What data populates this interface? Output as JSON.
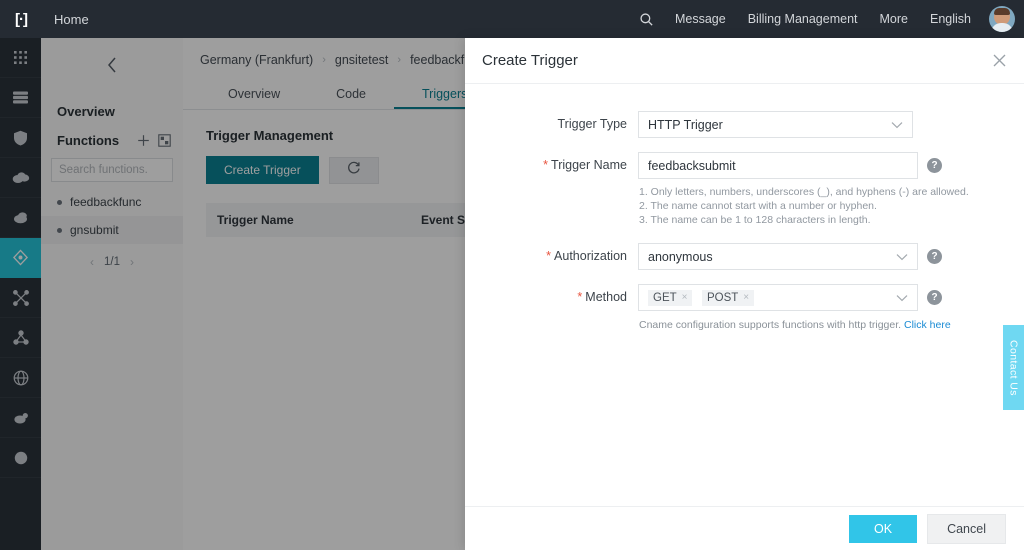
{
  "topbar": {
    "logo": "logo-icon",
    "home": "Home",
    "search_icon": "search-icon",
    "items": [
      {
        "label": "Message"
      },
      {
        "label": "Billing Management"
      },
      {
        "label": "More"
      },
      {
        "label": "English"
      }
    ],
    "avatar": "user-avatar"
  },
  "rail": {
    "items": [
      {
        "icon": "grid-apps-icon",
        "active": false
      },
      {
        "icon": "server-stack-icon",
        "active": false
      },
      {
        "icon": "shield-icon",
        "active": false
      },
      {
        "icon": "cloud-icon",
        "active": false
      },
      {
        "icon": "cloud-storage-icon",
        "active": false
      },
      {
        "icon": "function-compute-icon",
        "active": true
      },
      {
        "icon": "network-cross-icon",
        "active": false
      },
      {
        "icon": "nodes-icon",
        "active": false
      },
      {
        "icon": "globe-icon",
        "active": false
      },
      {
        "icon": "cdn-icon",
        "active": false
      },
      {
        "icon": "circle-icon",
        "active": false
      }
    ]
  },
  "sidebar": {
    "collapse_icon": "chevron-left-icon",
    "overview": "Overview",
    "functions_title": "Functions",
    "add_icon": "plus-icon",
    "import_icon": "import-icon",
    "search_placeholder": "Search functions.",
    "search_value": "",
    "items": [
      {
        "label": "feedbackfunc",
        "selected": false
      },
      {
        "label": "gnsubmit",
        "selected": true
      }
    ],
    "pager": {
      "prev": "‹",
      "page": "1/1",
      "next": "›"
    }
  },
  "main": {
    "breadcrumb": [
      "Germany (Frankfurt)",
      "gnsitetest",
      "feedbackfunc"
    ],
    "tabs": [
      {
        "label": "Overview",
        "active": false
      },
      {
        "label": "Code",
        "active": false
      },
      {
        "label": "Triggers",
        "active": true
      }
    ],
    "section_title": "Trigger Management",
    "create_button": "Create Trigger",
    "refresh_icon": "refresh-icon",
    "table": {
      "columns": [
        "Trigger Name",
        "Event Sou"
      ],
      "rows": []
    }
  },
  "modal": {
    "title": "Create Trigger",
    "close_icon": "close-icon",
    "fields": {
      "trigger_type": {
        "label": "Trigger Type",
        "required": false,
        "value": "HTTP Trigger",
        "caret": "chevron-down-icon"
      },
      "trigger_name": {
        "label": "Trigger Name",
        "required": true,
        "value": "feedbacksubmit",
        "help": "help-icon",
        "hints": [
          "1. Only letters, numbers, underscores (_), and hyphens (-) are allowed.",
          "2. The name cannot start with a number or hyphen.",
          "3. The name can be 1 to 128 characters in length."
        ]
      },
      "authorization": {
        "label": "Authorization",
        "required": true,
        "value": "anonymous",
        "caret": "chevron-down-icon",
        "help": "help-icon"
      },
      "method": {
        "label": "Method",
        "required": true,
        "tags": [
          "GET",
          "POST"
        ],
        "tag_remove": "×",
        "caret": "chevron-down-icon",
        "help": "help-icon",
        "note_text": "Cname configuration supports functions with http trigger. ",
        "note_link": "Click here"
      }
    },
    "ok_button": "OK",
    "cancel_button": "Cancel"
  },
  "contact": {
    "label": "Contact Us"
  },
  "colors": {
    "topbar_bg": "#252b33",
    "rail_bg": "#2b323b",
    "rail_active": "#26c6da",
    "tab_active": "#0b8294",
    "primary_btn": "#0b8294",
    "ok_btn": "#31c5e8",
    "required_star": "#e8543f",
    "link": "#1a8bd4",
    "contact_tab": "#6fd8f2"
  }
}
